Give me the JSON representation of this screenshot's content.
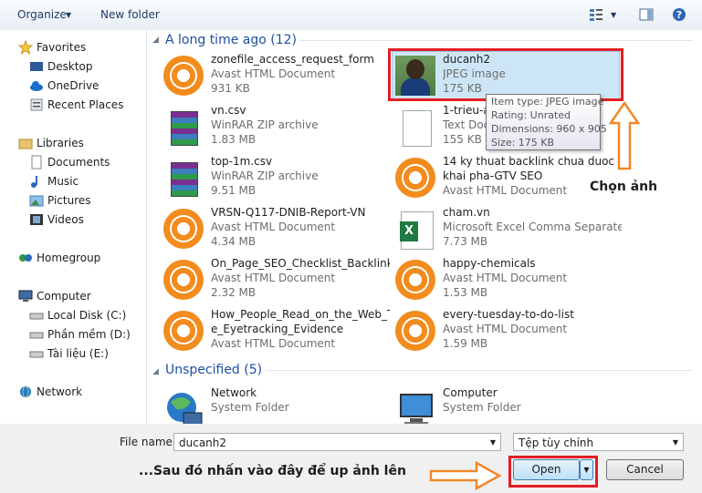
{
  "toolbar": {
    "organize": "Organize",
    "new_folder": "New folder"
  },
  "nav": {
    "favorites": "Favorites",
    "desktop": "Desktop",
    "onedrive": "OneDrive",
    "recent_places": "Recent Places",
    "libraries": "Libraries",
    "documents": "Documents",
    "music": "Music",
    "pictures": "Pictures",
    "videos": "Videos",
    "homegroup": "Homegroup",
    "computer": "Computer",
    "local_disk": "Local Disk (C:)",
    "phan_mem": "Phần mềm (D:)",
    "tai_lieu": "Tài liệu (E:)",
    "network": "Network"
  },
  "groups": {
    "long_time": "A long time ago (12)",
    "unspecified": "Unspecified (5)"
  },
  "files": [
    {
      "name": "zonefile_access_request_form",
      "type": "Avast HTML Document",
      "size": "931 KB"
    },
    {
      "name": "ducanh2",
      "type": "JPEG image",
      "size": "175 KB"
    },
    {
      "name": "vn.csv",
      "type": "WinRAR ZIP archive",
      "size": "1.83 MB"
    },
    {
      "name": "1-trieu-a",
      "type": "Text Doc",
      "size": "155 KB"
    },
    {
      "name": "top-1m.csv",
      "type": "WinRAR ZIP archive",
      "size": "9.51 MB"
    },
    {
      "name": "14 ky thuat backlink chua duoc",
      "name2": "khai pha-GTV SEO",
      "type": "Avast HTML Document",
      "size": ""
    },
    {
      "name": "VRSN-Q117-DNIB-Report-VN",
      "type": "Avast HTML Document",
      "size": "4.34 MB"
    },
    {
      "name": "cham.vn",
      "type": "Microsoft Excel Comma Separate...",
      "size": "7.73 MB"
    },
    {
      "name": "On_Page_SEO_Checklist_Backlinko",
      "type": "Avast HTML Document",
      "size": "2.32 MB"
    },
    {
      "name": "happy-chemicals",
      "type": "Avast HTML Document",
      "size": "1.53 MB"
    },
    {
      "name": "How_People_Read_on_the_Web_Th",
      "name2": "e_Eyetracking_Evidence",
      "type": "Avast HTML Document",
      "size": ""
    },
    {
      "name": "every-tuesday-to-do-list",
      "type": "Avast HTML Document",
      "size": "1.59 MB"
    }
  ],
  "unspecified": [
    {
      "name": "Network",
      "type": "System Folder"
    },
    {
      "name": "Computer",
      "type": "System Folder"
    }
  ],
  "tooltip": {
    "item_type": "Item type: JPEG image",
    "rating": "Rating: Unrated",
    "dimensions": "Dimensions: 960 x 905",
    "size": "Size: 175 KB"
  },
  "bottom": {
    "file_name_label": "File name:",
    "file_name_value": "ducanh2",
    "filter": "Tệp tùy chỉnh",
    "open": "Open",
    "cancel": "Cancel"
  },
  "annotations": {
    "chon_anh": "Chọn ảnh",
    "instruction": "...Sau đó nhấn vào đây để up ảnh lên"
  }
}
